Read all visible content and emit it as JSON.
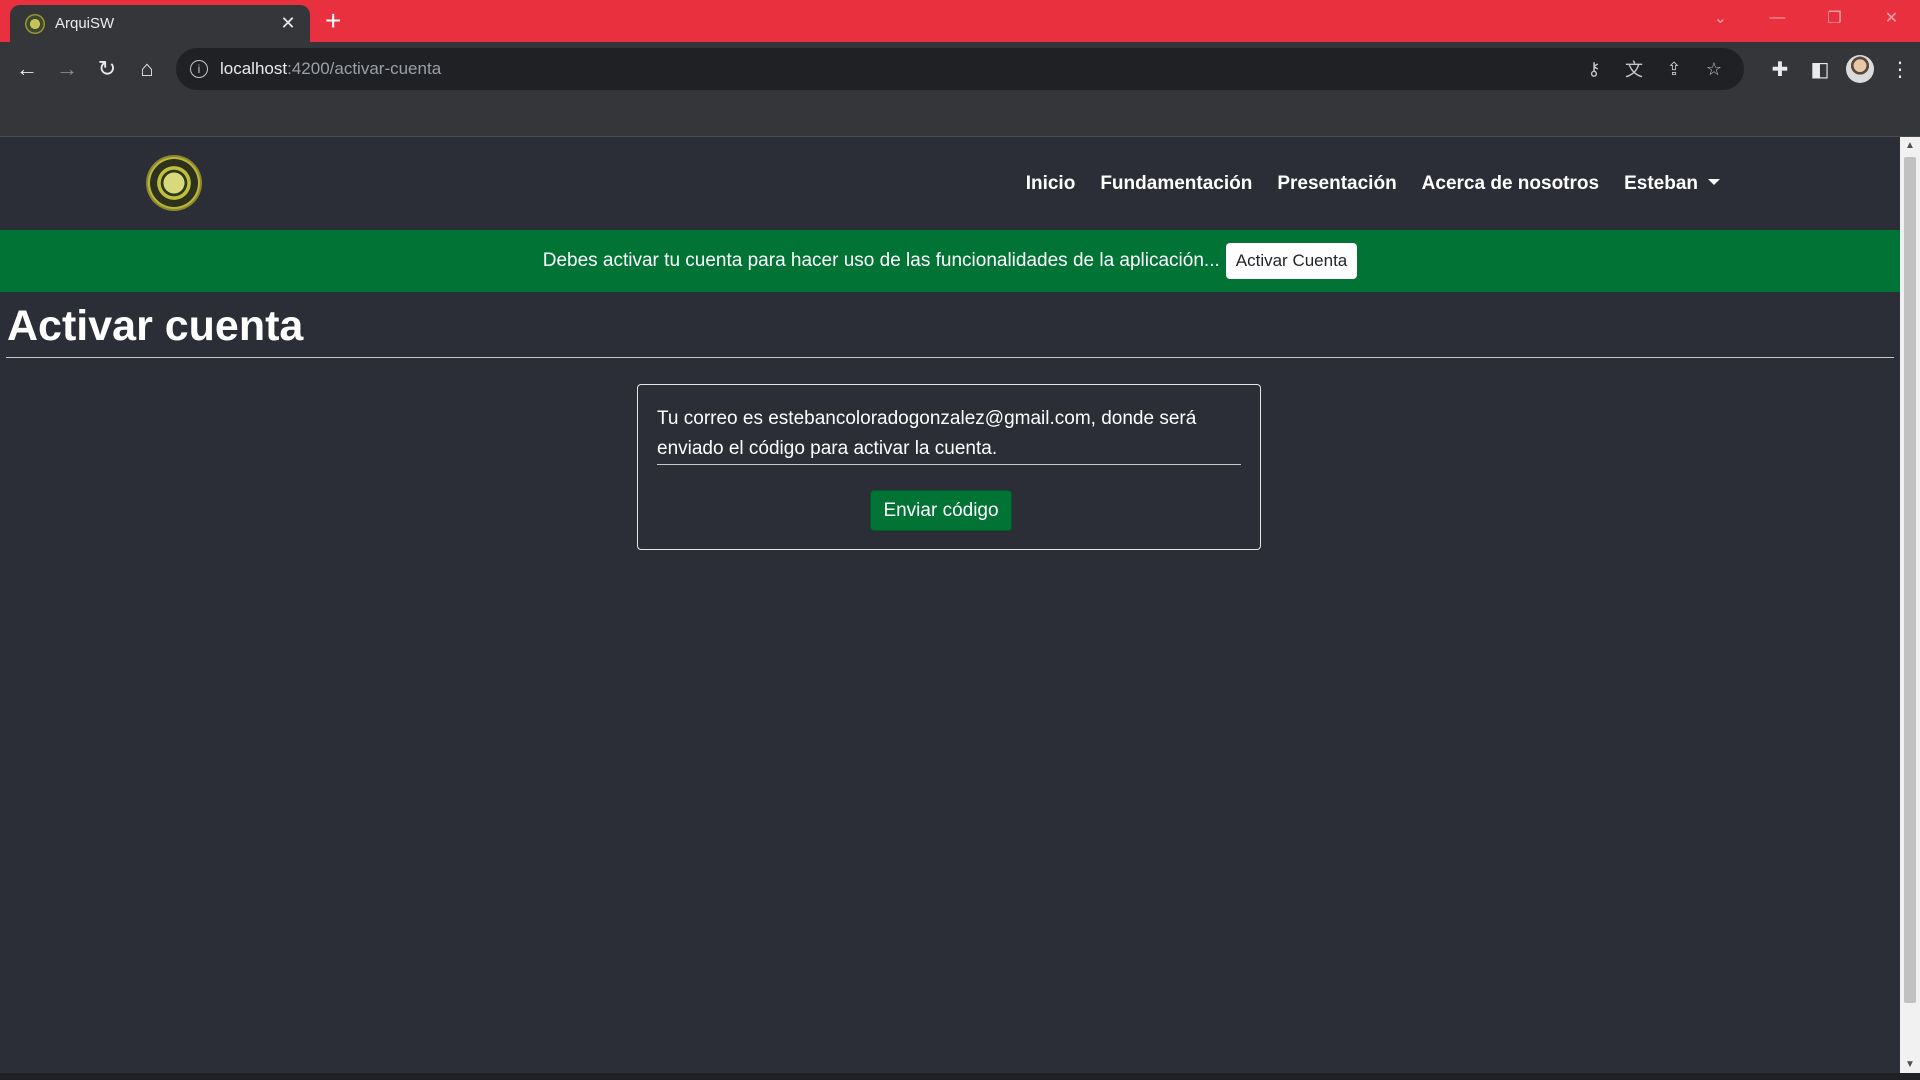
{
  "browser": {
    "tab_title": "ArquiSW",
    "tab_close": "✕",
    "new_tab": "+",
    "url_host": "localhost",
    "url_path": ":4200/activar-cuenta"
  },
  "navbar": {
    "links": [
      "Inicio",
      "Fundamentación",
      "Presentación",
      "Acerca de nosotros"
    ],
    "user_menu": "Esteban"
  },
  "alert": {
    "message": "Debes activar tu cuenta para hacer uso de las funcionalidades de la aplicación...",
    "button_label": "Activar Cuenta"
  },
  "main": {
    "title": "Activar cuenta",
    "card_text": "Tu correo es estebancoloradogonzalez@gmail.com, donde será enviado el código para activar la cuenta.",
    "send_button_label": "Enviar código"
  },
  "colors": {
    "titlebar": "#e9303f",
    "page_bg": "#2b2e37",
    "alert_bg": "#017335",
    "button_green": "#017335"
  }
}
